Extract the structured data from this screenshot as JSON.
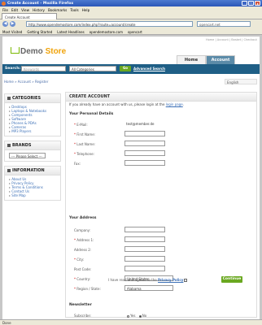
{
  "window": {
    "title": "Create Account - Mozilla Firefox",
    "min": "_",
    "max": "□",
    "close": "x"
  },
  "menu": [
    "File",
    "Edit",
    "View",
    "History",
    "Bookmarks",
    "Tools",
    "Help"
  ],
  "tab": {
    "label": "Create Account"
  },
  "nav": {
    "back": "◀",
    "forward": "▶",
    "url": "http://www.opendemostore.com/index.php?route=account/create",
    "search": "opencart.net"
  },
  "bookmarks": [
    "Most Visited",
    "Getting Started",
    "Latest Headlines",
    "opendemostore.com",
    "opencart"
  ],
  "store": {
    "logo_left": "Demo",
    "logo_right": "Store",
    "top_links": "Home | Account | Basket | Checkout"
  },
  "topnav": {
    "home": "Home",
    "account": "Account"
  },
  "search": {
    "label": "Search:",
    "keyword_placeholder": "Keywords",
    "category": "All Categories",
    "go": "Go",
    "advanced": "Advanced Search"
  },
  "breadcrumb": "Home » Account » Register",
  "language": "English",
  "sidebar": {
    "categories_title": "CATEGORIES",
    "categories": [
      "Desktops",
      "Laptops & Notebooks",
      "Components",
      "Software",
      "Phones & PDAs",
      "Cameras",
      "MP3 Players"
    ],
    "brands_title": "BRANDS",
    "brands_select": "--- Please Select ---",
    "information_title": "INFORMATION",
    "information": [
      "About Us",
      "Privacy Policy",
      "Terms & Conditions",
      "Contact Us",
      "Site Map"
    ]
  },
  "form": {
    "title": "CREATE ACCOUNT",
    "intro": "If you already have an account with us, please login at the",
    "intro_link": "login page",
    "personal_title": "Your Personal Details",
    "email_label": "E-Mail:",
    "email_value": "test@member.de",
    "firstname_label": "First Name:",
    "lastname_label": "Last Name:",
    "telephone_label": "Telephone:",
    "fax_label": "Fax:",
    "address_title": "Your Address",
    "company_label": "Company:",
    "address1_label": "Address 1:",
    "address2_label": "Address 2:",
    "city_label": "City:",
    "postcode_label": "Post Code:",
    "country_label": "Country:",
    "country_value": "United States",
    "region_label": "Region / State:",
    "region_value": "Alabama",
    "newsletter_title": "Newsletter",
    "subscribe_label": "Subscribe:",
    "yes": "Yes",
    "no": "No",
    "agree_text": "I have read and agreed to the",
    "agree_link": "Privacy Policy",
    "continue": "Continue"
  },
  "status": "Done"
}
